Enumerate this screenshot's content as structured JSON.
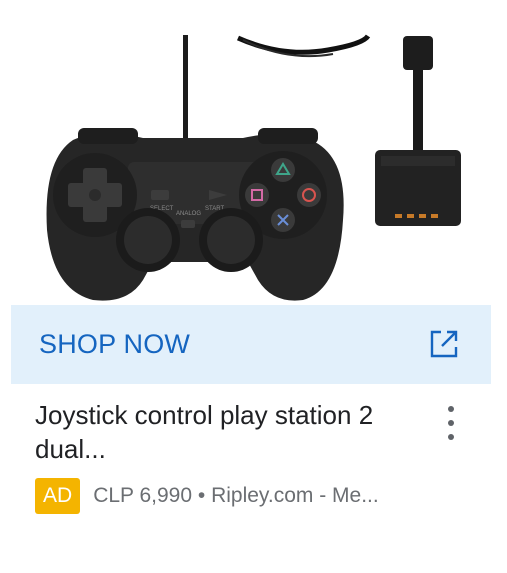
{
  "ad": {
    "shop_label": "SHOP NOW",
    "title": "Joystick control play station 2 dual...",
    "badge": "AD",
    "meta": "CLP 6,990 • Ripley.com - Me..."
  },
  "product": {
    "select_label": "SELECT",
    "start_label": "START",
    "analog_label": "ANALOG"
  },
  "colors": {
    "shop_bar_bg": "#e2f0fb",
    "shop_text": "#1565c0",
    "badge_bg": "#f4b400",
    "title_text": "#202124",
    "meta_text": "#6b6e72"
  },
  "icons": {
    "external": "external-link-icon",
    "menu": "more-vert-icon"
  }
}
